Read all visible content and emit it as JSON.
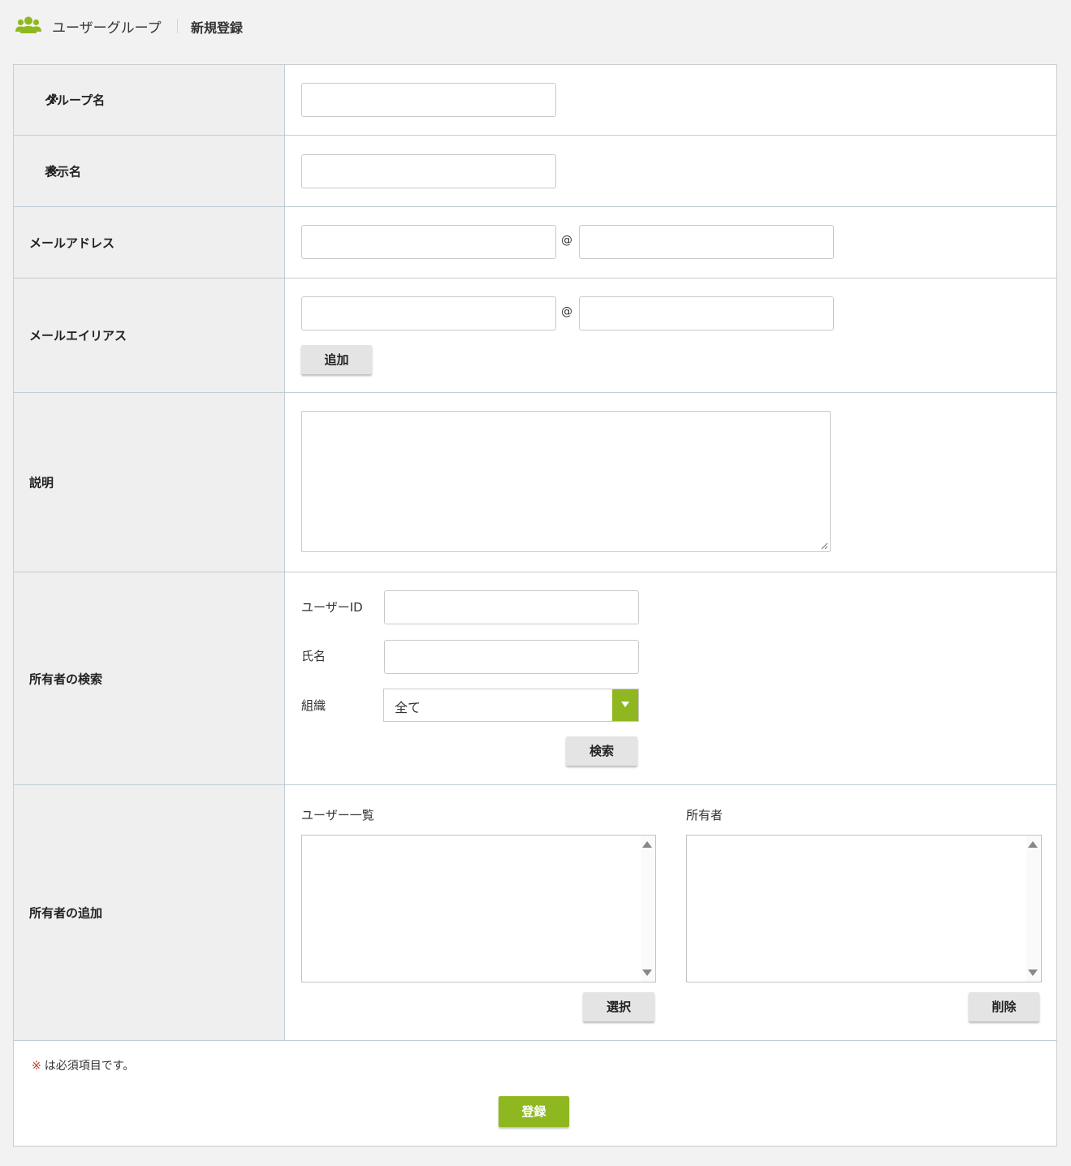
{
  "header": {
    "icon": "users-icon",
    "title": "ユーザーグループ",
    "subtitle": "新規登録",
    "accent_color": "#8fb820"
  },
  "required_mark": "※",
  "form": {
    "group_name": {
      "label": "グループ名",
      "value": ""
    },
    "display_name": {
      "label": "表示名",
      "value": ""
    },
    "mail_address": {
      "label": "メールアドレス",
      "at": "@",
      "local_value": "",
      "domain_value": ""
    },
    "mail_alias": {
      "label": "メールエイリアス",
      "at": "@",
      "local_value": "",
      "domain_value": "",
      "add_button": "追加"
    },
    "description": {
      "label": "説明",
      "value": ""
    },
    "owner_search": {
      "label": "所有者の検索",
      "user_id_label": "ユーザーID",
      "user_id_value": "",
      "name_label": "氏名",
      "name_value": "",
      "org_label": "組織",
      "org_selected": "全て",
      "search_button": "検索"
    },
    "owner_add": {
      "label": "所有者の追加",
      "user_list_label": "ユーザー一覧",
      "owners_label": "所有者",
      "select_button": "選択",
      "delete_button": "削除"
    }
  },
  "footer": {
    "note": "は必須項目です。",
    "submit_button": "登録"
  }
}
